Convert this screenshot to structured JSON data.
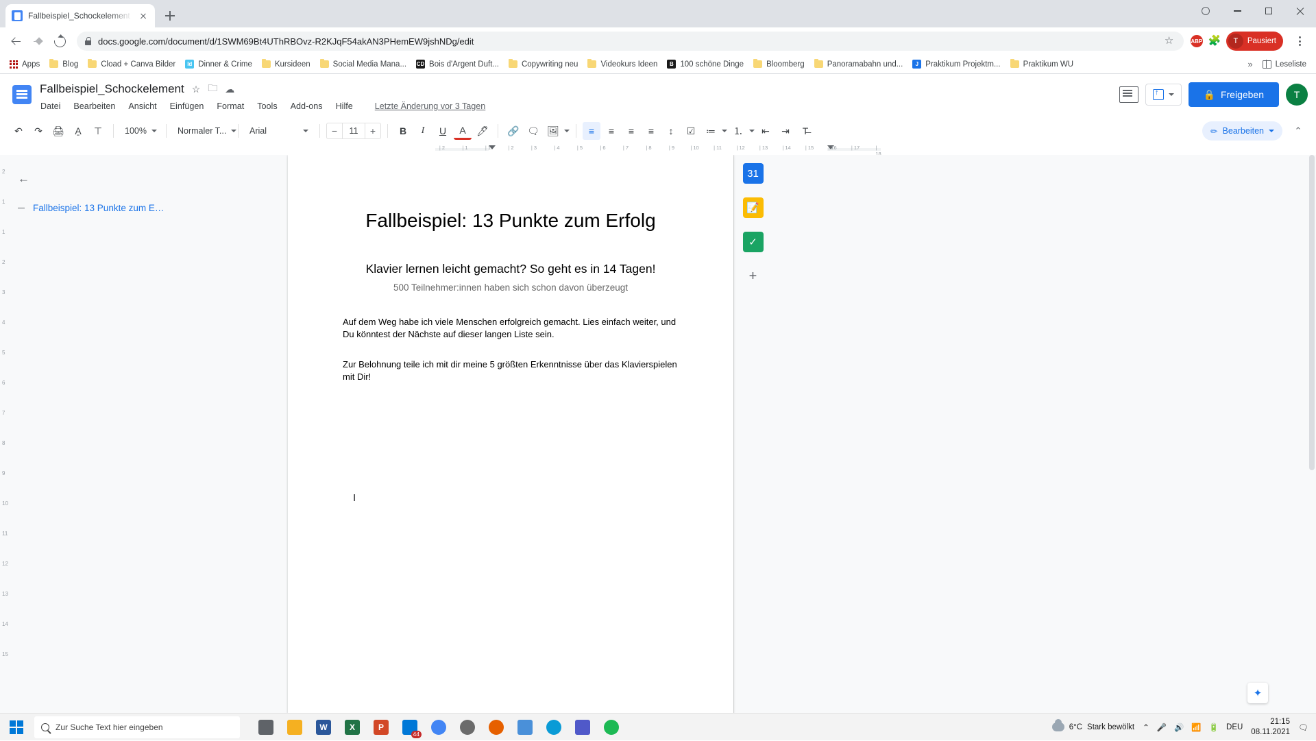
{
  "browser": {
    "tab": {
      "title": "Fallbeispiel_Schockelement - Go...",
      "favicon": "docs-icon"
    },
    "new_tab_label": "+",
    "url": "docs.google.com/document/d/1SWM69Bt4UThRBOvz-R2KJqF54akAN3PHemEW9jshNDg/edit",
    "profile_label": "Pausiert",
    "profile_initial": "T",
    "extension_badge": "ABP",
    "bookmarks": [
      {
        "label": "Apps",
        "icon": "apps-grid-icon",
        "color": "#b31412"
      },
      {
        "label": "Blog",
        "icon": "folder-icon",
        "color": "#f8d775"
      },
      {
        "label": "Cload + Canva Bilder",
        "icon": "folder-icon",
        "color": "#f8d775"
      },
      {
        "label": "Dinner & Crime",
        "icon": "indesign-icon",
        "color": "#49c5f1",
        "short": "Id"
      },
      {
        "label": "Kursideen",
        "icon": "folder-icon",
        "color": "#f8d775"
      },
      {
        "label": "Social Media Mana...",
        "icon": "folder-icon",
        "color": "#f8d775"
      },
      {
        "label": "Bois d'Argent Duft...",
        "icon": "site-icon",
        "color": "#1a1a1a",
        "short": "CD"
      },
      {
        "label": "Copywriting neu",
        "icon": "folder-icon",
        "color": "#f8d775"
      },
      {
        "label": "Videokurs Ideen",
        "icon": "folder-icon",
        "color": "#f8d775"
      },
      {
        "label": "100 schöne Dinge",
        "icon": "site-icon",
        "color": "#1a1a1a",
        "short": "B"
      },
      {
        "label": "Bloomberg",
        "icon": "folder-icon",
        "color": "#f8d775"
      },
      {
        "label": "Panoramabahn und...",
        "icon": "folder-icon",
        "color": "#f8d775"
      },
      {
        "label": "Praktikum Projektm...",
        "icon": "site-icon",
        "color": "#1a73e8",
        "short": "J"
      },
      {
        "label": "Praktikum WU",
        "icon": "folder-icon",
        "color": "#f8d775"
      }
    ],
    "bookmarks_overflow": "»",
    "reading_list": "Leseliste"
  },
  "docs": {
    "title": "Fallbeispiel_Schockelement",
    "title_icons": [
      "star-icon",
      "move-to-folder-icon",
      "cloud-saved-icon"
    ],
    "menus": [
      "Datei",
      "Bearbeiten",
      "Ansicht",
      "Einfügen",
      "Format",
      "Tools",
      "Add-ons",
      "Hilfe"
    ],
    "last_edit": "Letzte Änderung vor 3 Tagen",
    "share_label": "Freigeben",
    "avatar_initial": "T",
    "toolbar": {
      "zoom": "100%",
      "style": "Normaler T...",
      "font": "Arial",
      "font_size": "11",
      "minus": "−",
      "plus": "+",
      "bold": "B",
      "italic": "I",
      "underline": "U",
      "text_color": "A",
      "edit_mode": "Bearbeiten"
    },
    "outline": {
      "back_icon": "arrow-left-icon",
      "item": "Fallbeispiel: 13 Punkte zum E…"
    },
    "ruler_ticks": [
      "2",
      "1",
      "1",
      "2",
      "3",
      "4",
      "5",
      "6",
      "7",
      "8",
      "9",
      "10",
      "11",
      "12",
      "13",
      "14",
      "15",
      "16",
      "17",
      "18"
    ],
    "left_scale": [
      "2",
      "1",
      "1",
      "2",
      "3",
      "4",
      "5",
      "6",
      "7",
      "8",
      "9",
      "10",
      "11",
      "12",
      "13",
      "14",
      "15"
    ],
    "document": {
      "heading": "Fallbeispiel: 13 Punkte zum Erfolg",
      "subheading": "Klavier lernen leicht gemacht? So geht es in 14 Tagen!",
      "subtitle": "500 Teilnehmer:innen haben sich schon davon überzeugt",
      "paragraph1": "Auf dem Weg habe ich viele Menschen erfolgreich gemacht. Lies einfach weiter, und Du könntest der Nächste auf dieser langen Liste sein.",
      "paragraph2": "Zur Belohnung teile ich mit dir meine 5 größten Erkenntnisse über das Klavierspielen mit Dir!"
    }
  },
  "taskbar": {
    "search_placeholder": "Zur Suche Text hier eingeben",
    "apps": [
      {
        "name": "task-view-icon",
        "label": "",
        "color": "#5f6368"
      },
      {
        "name": "file-explorer-icon",
        "label": "",
        "color": "#f5b021"
      },
      {
        "name": "word-icon",
        "label": "W",
        "color": "#2b579a"
      },
      {
        "name": "excel-icon",
        "label": "X",
        "color": "#217346"
      },
      {
        "name": "powerpoint-icon",
        "label": "P",
        "color": "#d24726"
      },
      {
        "name": "mail-icon",
        "label": "",
        "color": "#0078d7",
        "badge": "44"
      },
      {
        "name": "chrome-icon",
        "label": "",
        "color": "#4285f4"
      },
      {
        "name": "disc-icon",
        "label": "",
        "color": "#6b6b6b"
      },
      {
        "name": "firefox-icon",
        "label": "",
        "color": "#e66000"
      },
      {
        "name": "snip-icon",
        "label": "",
        "color": "#4a90d9"
      },
      {
        "name": "edge-icon",
        "label": "",
        "color": "#0a9bd6"
      },
      {
        "name": "teams-icon",
        "label": "",
        "color": "#5059c9"
      },
      {
        "name": "spotify-icon",
        "label": "",
        "color": "#1db954"
      }
    ],
    "weather_temp": "6°C",
    "weather_desc": "Stark bewölkt",
    "language": "DEU",
    "time": "21:15",
    "date": "08.11.2021"
  }
}
